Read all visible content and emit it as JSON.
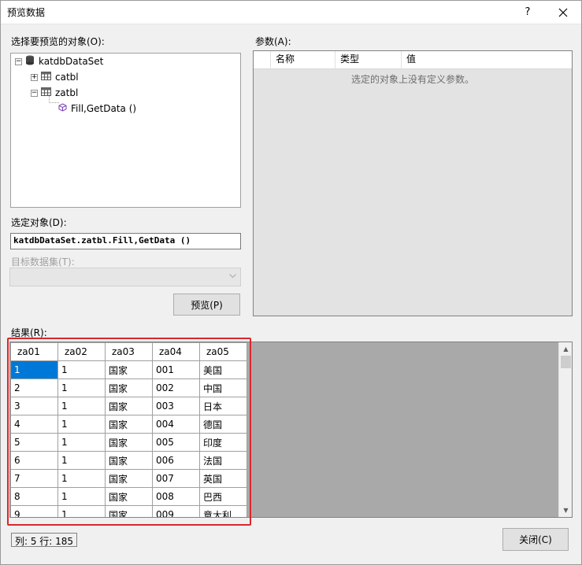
{
  "window": {
    "title": "预览数据",
    "help_glyph": "?",
    "close_icon": "close-icon"
  },
  "object_picker": {
    "label": "选择要预览的对象(O):",
    "tree": {
      "root": "katdbDataSet",
      "children": [
        {
          "label": "catbl",
          "expanded": false
        },
        {
          "label": "zatbl",
          "expanded": true,
          "children": [
            {
              "label": "Fill,GetData ()"
            }
          ]
        }
      ]
    }
  },
  "selected_object": {
    "label": "选定对象(D):",
    "value": "katdbDataSet.zatbl.Fill,GetData ()"
  },
  "target_dataset": {
    "label": "目标数据集(T):",
    "value": ""
  },
  "preview_button": "预览(P)",
  "parameters": {
    "label": "参数(A):",
    "columns": [
      "名称",
      "类型",
      "值"
    ],
    "empty_text": "选定的对象上没有定义参数。"
  },
  "results": {
    "label": "结果(R):",
    "columns": [
      "za01",
      "za02",
      "za03",
      "za04",
      "za05"
    ],
    "rows": [
      [
        "1",
        "1",
        "国家",
        "001",
        "美国"
      ],
      [
        "2",
        "1",
        "国家",
        "002",
        "中国"
      ],
      [
        "3",
        "1",
        "国家",
        "003",
        "日本"
      ],
      [
        "4",
        "1",
        "国家",
        "004",
        "德国"
      ],
      [
        "5",
        "1",
        "国家",
        "005",
        "印度"
      ],
      [
        "6",
        "1",
        "国家",
        "006",
        "法国"
      ],
      [
        "7",
        "1",
        "国家",
        "007",
        "英国"
      ],
      [
        "8",
        "1",
        "国家",
        "008",
        "巴西"
      ],
      [
        "9",
        "1",
        "国家",
        "009",
        "意大利"
      ]
    ]
  },
  "status": "列: 5  行: 185",
  "close_button": "关闭(C)",
  "colors": {
    "highlight": "#d9282d",
    "selection": "#0078d7"
  }
}
